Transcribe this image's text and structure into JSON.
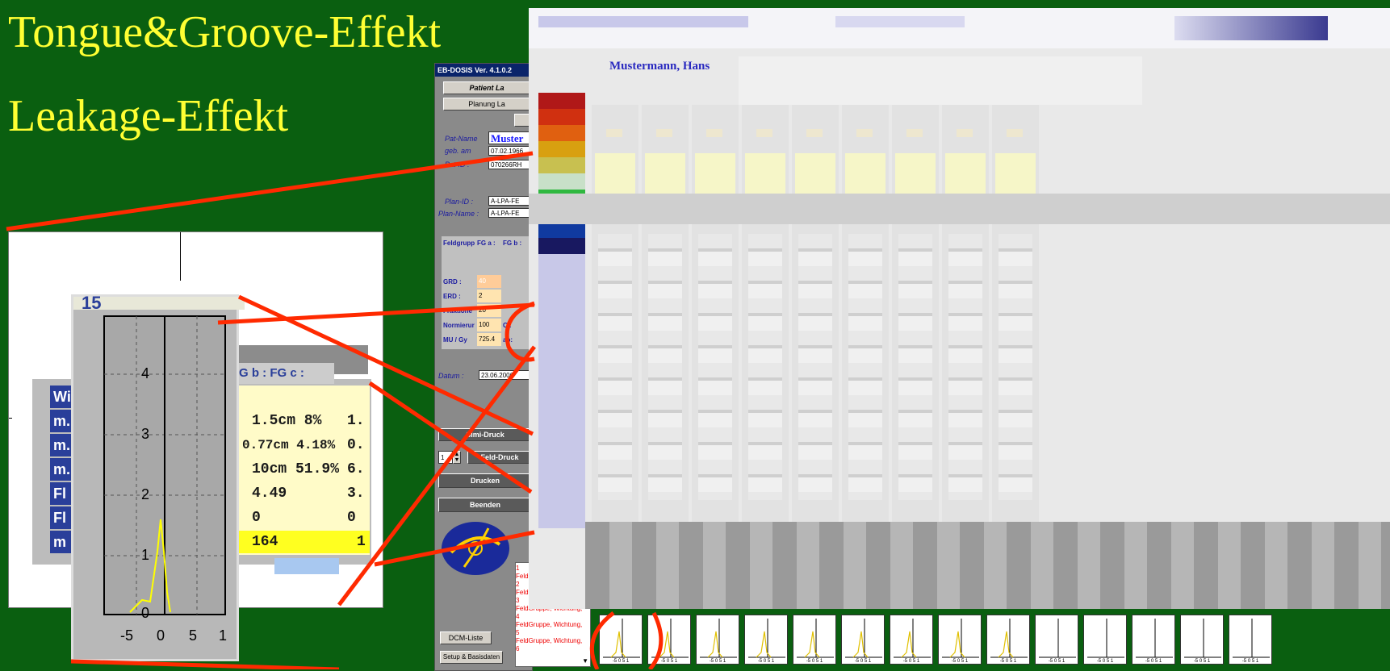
{
  "slide": {
    "title_line1": "Tongue&Groove-Effekt",
    "title_line2": "Leakage-Effekt"
  },
  "eb_window": {
    "title": "EB-DOSIS Ver. 4.1.0.2",
    "buttons": {
      "patient_load": "Patient La",
      "plan_load": "Planung La",
      "simi_print": "Simi-Druck",
      "field_print": "Feld-Druck",
      "print": "Drucken",
      "exit": "Beenden",
      "dcm_list": "DCM-Liste",
      "setup": "Setup & Basisdaten"
    },
    "labels": {
      "pat_name": "Pat-Name",
      "birth": "geb. am",
      "pat_id": "Pat-ID :",
      "plan_id": "Plan-ID :",
      "plan_name": "Plan-Name :",
      "date": "Datum :"
    },
    "values": {
      "pat_name": "Muster",
      "birth": "07.02.1966",
      "pat_id": "070266RH",
      "plan_id": "A-LPA-FE",
      "plan_name": "A-LPA-FE",
      "date": "23.06.2006",
      "copies": "1"
    },
    "grid": {
      "headers": [
        "Feldgrupp",
        "FG a :",
        "FG b :"
      ],
      "rows": [
        {
          "label": "GRD :",
          "value": "40"
        },
        {
          "label": "ERD :",
          "value": "2"
        },
        {
          "label": "Fraktione",
          "value": "20"
        },
        {
          "label": "Normierur",
          "value": "100"
        },
        {
          "label": "MU / Gy",
          "value": "725.4"
        }
      ],
      "extra": [
        "C :",
        "ab:"
      ]
    },
    "log_items": [
      "1",
      "Feld",
      "2",
      "Feld",
      "3",
      "FeldGruppe, Wichtung,",
      "4",
      "FeldGruppe, Wichtung,",
      "5",
      "FeldGruppe, Wichtung,",
      "6"
    ]
  },
  "report_panel": {
    "patient": "Mustermann, Hans"
  },
  "zoom": {
    "top_label": "15",
    "header_cells": [
      "G b :",
      "FG c :"
    ],
    "row_labels": [
      "Wi",
      "m.",
      "m.",
      "m.",
      "Fl",
      "Fl",
      "m"
    ],
    "rows": [
      [
        "1.5cm 8%",
        "1."
      ],
      [
        "0.77cm 4.18%",
        "0."
      ],
      [
        "10cm 51.9%",
        "6."
      ],
      [
        "4.49",
        "3."
      ],
      [
        "0",
        "0"
      ],
      [
        "164",
        "1"
      ]
    ],
    "plot": {
      "y_ticks": [
        "4",
        "3",
        "2",
        "1",
        "0"
      ],
      "x_ticks": [
        "-5",
        "0",
        "5",
        "1"
      ]
    }
  },
  "thumbs": {
    "count": 14,
    "x_ticks": [
      "-5",
      "0",
      "5",
      "1"
    ]
  },
  "colors": {
    "background": "#0a5f10",
    "title": "#ffff33",
    "callout": "#ff2a00"
  }
}
